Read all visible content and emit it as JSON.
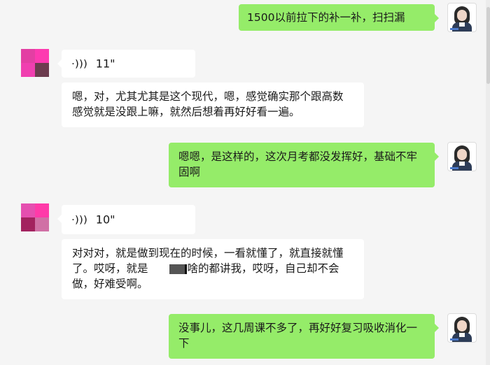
{
  "messages": [
    {
      "sender": "self",
      "type": "text",
      "text": "1500以前拉下的补一补，扫扫漏"
    },
    {
      "sender": "other",
      "type": "voice",
      "duration": "11\""
    },
    {
      "sender": "other",
      "type": "text",
      "text": "嗯，对，尤其尤其是这个现代，嗯，感觉确实那个跟高数感觉就是没跟上嘛，就然后想着再好好看一遍。"
    },
    {
      "sender": "self",
      "type": "text",
      "text": "嗯嗯，是这样的，这次月考都没发挥好，基础不牢固啊"
    },
    {
      "sender": "other",
      "type": "voice",
      "duration": "10\""
    },
    {
      "sender": "other",
      "type": "text",
      "text_before": "对对对，就是做到现在的时候，一看就懂了，就直接就懂了。哎呀，就是",
      "text_after": "啥的都讲我，哎呀，自己却不会做，好难受啊。"
    },
    {
      "sender": "self",
      "type": "text",
      "text": "没事儿，这几周课不多了，再好好复习吸收消化一下"
    }
  ],
  "avatar_other_1": [
    "#e33fa3",
    "#fd3ab0",
    "#f03fb0",
    "#6c3c4e"
  ],
  "avatar_other_2": [
    "#e54fb0",
    "#ff3aa9",
    "#a3235f",
    "#d070a5"
  ],
  "colors": {
    "self_bubble": "#95ec69",
    "other_bubble": "#ffffff",
    "background": "#f5f5f5"
  }
}
